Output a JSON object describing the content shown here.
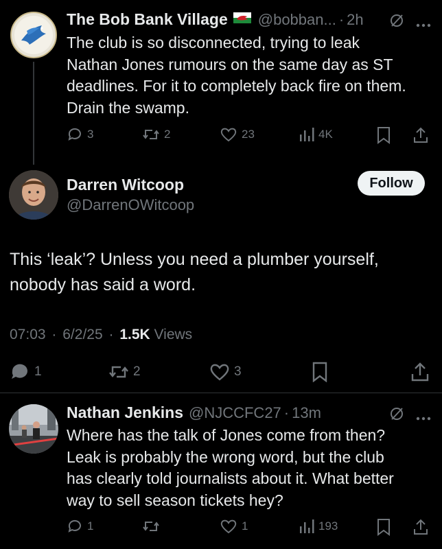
{
  "tweet1": {
    "display_name": "The Bob Bank Village",
    "handle": "@bobban...",
    "separator": "·",
    "time": "2h",
    "text_lines": [
      "The club is so disconnected, trying to leak",
      "Nathan Jones rumours on the same day as ST",
      "deadlines. For it to completely back fire on them.",
      "Drain the swamp."
    ],
    "replies": "3",
    "reposts": "2",
    "likes": "23",
    "views": "4K",
    "accent": "#4a90d9"
  },
  "main": {
    "display_name": "Darren Witcoop",
    "handle": "@DarrenOWitcoop",
    "follow_label": "Follow",
    "text_lines": [
      "This ‘leak’? Unless you need a plumber yourself,",
      "nobody has said a word."
    ],
    "time": "07:03",
    "sep1": "·",
    "date": "6/2/25",
    "sep2": "·",
    "views_count": "1.5K",
    "views_label": "Views",
    "replies": "1",
    "reposts": "2",
    "likes": "3"
  },
  "reply": {
    "display_name": "Nathan Jenkins",
    "handle": "@NJCCFC27",
    "separator": "·",
    "time": "13m",
    "text_lines": [
      "Where has the talk of Jones come from then?",
      "Leak is probably the wrong word, but the club",
      "has clearly told journalists about it. What better",
      "way to sell season tickets hey?"
    ],
    "replies": "1",
    "reposts": "",
    "likes": "1",
    "views": "193"
  }
}
